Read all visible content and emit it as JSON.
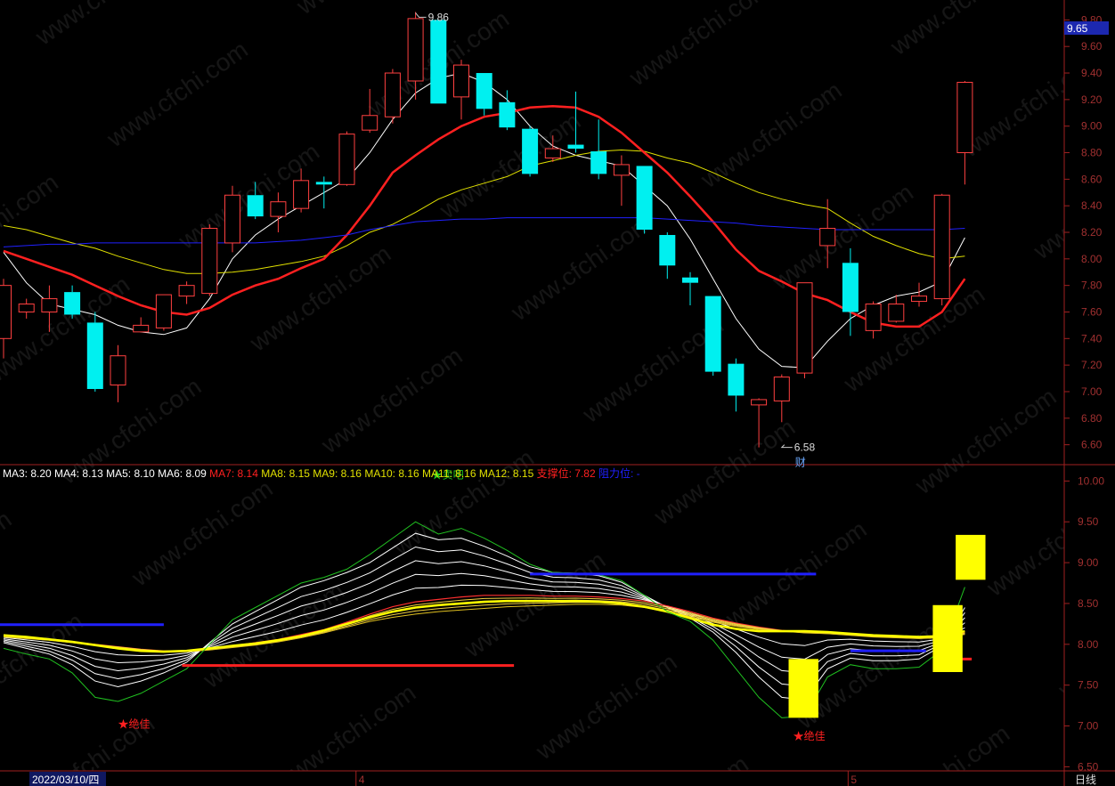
{
  "chart_data": [
    {
      "type": "candlestick",
      "name": "price",
      "ylim": [
        6.45,
        9.95
      ],
      "yticks": [
        9.8,
        9.6,
        9.4,
        9.2,
        9.0,
        8.8,
        8.6,
        8.4,
        8.2,
        8.0,
        7.8,
        7.6,
        7.4,
        7.2,
        7.0,
        6.8,
        6.6
      ],
      "ytick_labels": [
        "9.80",
        "9.60",
        "9.40",
        "9.20",
        "9.00",
        "8.80",
        "8.60",
        "8.40",
        "8.20",
        "8.00",
        "7.80",
        "7.60",
        "7.40",
        "7.20",
        "7.00",
        "6.80",
        "6.60"
      ],
      "current_price": 9.65,
      "current_price_label": "9.65",
      "high_marker": {
        "index": 18,
        "value": 9.86,
        "label": "9.86"
      },
      "low_marker": {
        "index": 34,
        "value": 6.58,
        "label": "6.58",
        "tag": "财"
      },
      "candles": [
        {
          "o": 7.4,
          "c": 7.8,
          "h": 7.85,
          "l": 7.25
        },
        {
          "o": 7.6,
          "c": 7.66,
          "h": 7.7,
          "l": 7.55
        },
        {
          "o": 7.6,
          "c": 7.7,
          "h": 7.8,
          "l": 7.45
        },
        {
          "o": 7.75,
          "c": 7.58,
          "h": 7.8,
          "l": 7.55
        },
        {
          "o": 7.52,
          "c": 7.02,
          "h": 7.6,
          "l": 7.0
        },
        {
          "o": 7.05,
          "c": 7.27,
          "h": 7.35,
          "l": 6.92
        },
        {
          "o": 7.45,
          "c": 7.5,
          "h": 7.56,
          "l": 7.45
        },
        {
          "o": 7.48,
          "c": 7.73,
          "h": 7.73,
          "l": 7.46
        },
        {
          "o": 7.72,
          "c": 7.8,
          "h": 7.83,
          "l": 7.66
        },
        {
          "o": 7.74,
          "c": 8.23,
          "h": 8.26,
          "l": 7.72
        },
        {
          "o": 8.12,
          "c": 8.48,
          "h": 8.55,
          "l": 8.05
        },
        {
          "o": 8.48,
          "c": 8.32,
          "h": 8.58,
          "l": 8.3
        },
        {
          "o": 8.32,
          "c": 8.43,
          "h": 8.5,
          "l": 8.2
        },
        {
          "o": 8.38,
          "c": 8.59,
          "h": 8.68,
          "l": 8.35
        },
        {
          "o": 8.58,
          "c": 8.56,
          "h": 8.62,
          "l": 8.38
        },
        {
          "o": 8.56,
          "c": 8.94,
          "h": 8.96,
          "l": 8.55
        },
        {
          "o": 8.97,
          "c": 9.08,
          "h": 9.28,
          "l": 8.95
        },
        {
          "o": 9.07,
          "c": 9.4,
          "h": 9.43,
          "l": 9.02
        },
        {
          "o": 9.34,
          "c": 9.81,
          "h": 9.86,
          "l": 9.2
        },
        {
          "o": 9.8,
          "c": 9.17,
          "h": 9.8,
          "l": 9.17
        },
        {
          "o": 9.22,
          "c": 9.46,
          "h": 9.5,
          "l": 9.05
        },
        {
          "o": 9.4,
          "c": 9.13,
          "h": 9.4,
          "l": 9.08
        },
        {
          "o": 9.18,
          "c": 8.99,
          "h": 9.27,
          "l": 8.97
        },
        {
          "o": 8.98,
          "c": 8.64,
          "h": 9.0,
          "l": 8.62
        },
        {
          "o": 8.76,
          "c": 8.83,
          "h": 8.93,
          "l": 8.73
        },
        {
          "o": 8.86,
          "c": 8.83,
          "h": 9.26,
          "l": 8.8
        },
        {
          "o": 8.81,
          "c": 8.64,
          "h": 9.05,
          "l": 8.6
        },
        {
          "o": 8.63,
          "c": 8.71,
          "h": 8.78,
          "l": 8.4
        },
        {
          "o": 8.7,
          "c": 8.22,
          "h": 8.7,
          "l": 8.19
        },
        {
          "o": 8.18,
          "c": 7.95,
          "h": 8.2,
          "l": 7.85
        },
        {
          "o": 7.86,
          "c": 7.82,
          "h": 7.9,
          "l": 7.65
        },
        {
          "o": 7.72,
          "c": 7.15,
          "h": 7.72,
          "l": 7.12
        },
        {
          "o": 7.21,
          "c": 6.97,
          "h": 7.25,
          "l": 6.85
        },
        {
          "o": 6.9,
          "c": 6.94,
          "h": 6.95,
          "l": 6.58
        },
        {
          "o": 6.93,
          "c": 7.11,
          "h": 7.13,
          "l": 6.77
        },
        {
          "o": 7.14,
          "c": 7.82,
          "h": 7.82,
          "l": 7.1
        },
        {
          "o": 8.1,
          "c": 8.23,
          "h": 8.45,
          "l": 7.93
        },
        {
          "o": 7.97,
          "c": 7.6,
          "h": 8.08,
          "l": 7.42
        },
        {
          "o": 7.46,
          "c": 7.66,
          "h": 7.68,
          "l": 7.4
        },
        {
          "o": 7.53,
          "c": 7.66,
          "h": 7.73,
          "l": 7.52
        },
        {
          "o": 7.68,
          "c": 7.72,
          "h": 7.82,
          "l": 7.64
        },
        {
          "o": 7.7,
          "c": 8.48,
          "h": 8.49,
          "l": 7.65
        },
        {
          "o": 8.8,
          "c": 9.33,
          "h": 9.34,
          "l": 8.56
        }
      ],
      "ma_lines": [
        {
          "color": "#ffffff",
          "width": 1,
          "values": [
            8.05,
            7.82,
            7.66,
            7.62,
            7.58,
            7.5,
            7.45,
            7.43,
            7.48,
            7.7,
            8.0,
            8.18,
            8.3,
            8.4,
            8.5,
            8.6,
            8.8,
            9.05,
            9.25,
            9.36,
            9.4,
            9.33,
            9.2,
            9.0,
            8.85,
            8.78,
            8.74,
            8.7,
            8.55,
            8.4,
            8.15,
            7.85,
            7.55,
            7.32,
            7.19,
            7.18,
            7.38,
            7.55,
            7.65,
            7.72,
            7.75,
            7.83,
            8.16
          ]
        },
        {
          "color": "#e0e000",
          "width": 1,
          "values": [
            8.25,
            8.22,
            8.17,
            8.12,
            8.08,
            8.02,
            7.97,
            7.92,
            7.89,
            7.89,
            7.9,
            7.92,
            7.95,
            7.98,
            8.02,
            8.1,
            8.2,
            8.26,
            8.35,
            8.45,
            8.52,
            8.57,
            8.62,
            8.7,
            8.74,
            8.78,
            8.81,
            8.82,
            8.81,
            8.76,
            8.72,
            8.65,
            8.57,
            8.5,
            8.45,
            8.41,
            8.38,
            8.27,
            8.17,
            8.1,
            8.04,
            8.0,
            8.02
          ]
        },
        {
          "color": "#ff2020",
          "width": 2.5,
          "values": [
            8.06,
            8.0,
            7.94,
            7.88,
            7.8,
            7.72,
            7.65,
            7.6,
            7.58,
            7.63,
            7.73,
            7.8,
            7.85,
            7.93,
            8.0,
            8.18,
            8.4,
            8.65,
            8.78,
            8.9,
            9.0,
            9.07,
            9.1,
            9.14,
            9.15,
            9.14,
            9.07,
            8.95,
            8.8,
            8.65,
            8.47,
            8.28,
            8.07,
            7.91,
            7.83,
            7.74,
            7.69,
            7.6,
            7.52,
            7.49,
            7.49,
            7.6,
            7.85
          ]
        },
        {
          "color": "#2020ff",
          "width": 1,
          "values": [
            8.09,
            8.1,
            8.11,
            8.11,
            8.12,
            8.12,
            8.12,
            8.12,
            8.12,
            8.12,
            8.12,
            8.12,
            8.13,
            8.14,
            8.16,
            8.18,
            8.22,
            8.25,
            8.28,
            8.29,
            8.3,
            8.3,
            8.31,
            8.31,
            8.31,
            8.31,
            8.31,
            8.31,
            8.31,
            8.3,
            8.29,
            8.28,
            8.27,
            8.25,
            8.24,
            8.23,
            8.22,
            8.22,
            8.22,
            8.22,
            8.22,
            8.22,
            8.23
          ]
        }
      ]
    },
    {
      "type": "line",
      "name": "indicator",
      "ylim": [
        6.45,
        10.2
      ],
      "yticks": [
        10.0,
        9.5,
        9.0,
        8.5,
        8.0,
        7.5,
        7.0,
        6.5
      ],
      "ytick_labels": [
        "10.00",
        "9.50",
        "9.00",
        "8.50",
        "8.00",
        "7.50",
        "7.00",
        "6.50"
      ],
      "legend": [
        {
          "label": "MA3:",
          "value": "8.20",
          "color": "#ffffff"
        },
        {
          "label": "MA4:",
          "value": "8.13",
          "color": "#ffffff"
        },
        {
          "label": "MA5:",
          "value": "8.10",
          "color": "#ffffff"
        },
        {
          "label": "MA6:",
          "value": "8.09",
          "color": "#ffffff"
        },
        {
          "label": "MA7:",
          "value": "8.14",
          "color": "#ff2020"
        },
        {
          "label": "MA8:",
          "value": "8.15",
          "color": "#e0e000"
        },
        {
          "label": "MA9:",
          "value": "8.16",
          "color": "#e0e000"
        },
        {
          "label": "MA10:",
          "value": "8.16",
          "color": "#e0e000"
        },
        {
          "label": "MA11:",
          "value": "8.16",
          "color": "#e0e000"
        },
        {
          "label": "MA12:",
          "value": "8.15",
          "color": "#e0e000"
        },
        {
          "label": "支撑位:",
          "value": "7.82",
          "color": "#ff2020"
        },
        {
          "label": "阻力位:",
          "value": "-",
          "color": "#2020ff"
        }
      ],
      "signals": [
        {
          "text": "★卖吧",
          "index": 18.7,
          "value": 10.03,
          "color": "#20d020"
        },
        {
          "text": "★绝佳",
          "index": 5.0,
          "value": 6.98,
          "color": "#ff2020"
        },
        {
          "text": "★绝佳",
          "index": 34.5,
          "value": 6.83,
          "color": "#ff2020"
        }
      ],
      "levels": [
        {
          "color": "#2020ff",
          "from": -0.3,
          "to": 7.0,
          "value": 8.24
        },
        {
          "color": "#ff2020",
          "from": 7.8,
          "to": 22.3,
          "value": 7.74
        },
        {
          "color": "#2020ff",
          "from": 23.0,
          "to": 35.5,
          "value": 8.86
        },
        {
          "color": "#2020ff",
          "from": 37.0,
          "to": 40.3,
          "value": 7.92
        },
        {
          "color": "#ff2020",
          "from": 41.2,
          "to": 42.3,
          "value": 7.82
        }
      ],
      "boxes": [
        {
          "color": "#ffff00",
          "from": 34.3,
          "to": 35.6,
          "top": 7.82,
          "bottom": 7.1
        },
        {
          "color": "#ffff00",
          "from": 40.6,
          "to": 41.9,
          "top": 8.48,
          "bottom": 7.66
        },
        {
          "color": "#ffff00",
          "from": 41.6,
          "to": 42.9,
          "top": 9.34,
          "bottom": 8.79
        }
      ],
      "bundle": {
        "green": [
          7.95,
          7.88,
          7.82,
          7.65,
          7.35,
          7.3,
          7.4,
          7.55,
          7.7,
          8.0,
          8.3,
          8.45,
          8.6,
          8.75,
          8.82,
          8.92,
          9.1,
          9.3,
          9.5,
          9.35,
          9.42,
          9.3,
          9.15,
          8.98,
          8.88,
          8.87,
          8.85,
          8.78,
          8.6,
          8.4,
          8.28,
          8.05,
          7.7,
          7.35,
          7.1,
          7.12,
          7.6,
          7.75,
          7.7,
          7.7,
          7.72,
          7.93,
          8.7
        ],
        "white_top": [
          8.02,
          7.95,
          7.88,
          7.75,
          7.55,
          7.48,
          7.55,
          7.65,
          7.78,
          8.02,
          8.25,
          8.4,
          8.55,
          8.7,
          8.78,
          8.88,
          9.0,
          9.18,
          9.36,
          9.28,
          9.3,
          9.2,
          9.08,
          8.95,
          8.88,
          8.87,
          8.84,
          8.76,
          8.6,
          8.45,
          8.32,
          8.15,
          7.9,
          7.6,
          7.35,
          7.32,
          7.7,
          7.83,
          7.8,
          7.8,
          7.82,
          7.98,
          8.45
        ],
        "red": [
          8.1,
          8.08,
          8.06,
          8.03,
          8.0,
          7.97,
          7.94,
          7.92,
          7.92,
          7.94,
          7.98,
          8.02,
          8.06,
          8.12,
          8.18,
          8.27,
          8.37,
          8.46,
          8.52,
          8.55,
          8.58,
          8.6,
          8.6,
          8.6,
          8.59,
          8.59,
          8.58,
          8.56,
          8.53,
          8.47,
          8.4,
          8.32,
          8.26,
          8.21,
          8.17,
          8.15,
          8.14,
          8.12,
          8.1,
          8.09,
          8.08,
          8.09,
          8.14
        ],
        "yellow_low": [
          8.09,
          8.07,
          8.05,
          8.02,
          7.99,
          7.96,
          7.93,
          7.91,
          7.91,
          7.93,
          7.96,
          7.99,
          8.03,
          8.08,
          8.14,
          8.21,
          8.28,
          8.33,
          8.37,
          8.4,
          8.42,
          8.44,
          8.46,
          8.47,
          8.48,
          8.49,
          8.49,
          8.48,
          8.45,
          8.4,
          8.34,
          8.27,
          8.22,
          8.18,
          8.16,
          8.14,
          8.13,
          8.11,
          8.09,
          8.08,
          8.07,
          8.08,
          8.12
        ],
        "yellow_thick": [
          8.11,
          8.09,
          8.06,
          8.03,
          7.99,
          7.95,
          7.92,
          7.91,
          7.92,
          7.95,
          7.98,
          8.01,
          8.05,
          8.1,
          8.17,
          8.25,
          8.33,
          8.4,
          8.45,
          8.48,
          8.5,
          8.52,
          8.53,
          8.53,
          8.53,
          8.53,
          8.52,
          8.5,
          8.46,
          8.4,
          8.32,
          8.24,
          8.19,
          8.16,
          8.16,
          8.16,
          8.15,
          8.13,
          8.11,
          8.1,
          8.09,
          8.1,
          8.16
        ]
      }
    }
  ],
  "xaxis": {
    "start_date": "2022/03/10/四",
    "month_labels": [
      {
        "index": 15.4,
        "text": "4"
      },
      {
        "index": 36.9,
        "text": "5"
      }
    ],
    "period": "日线"
  }
}
